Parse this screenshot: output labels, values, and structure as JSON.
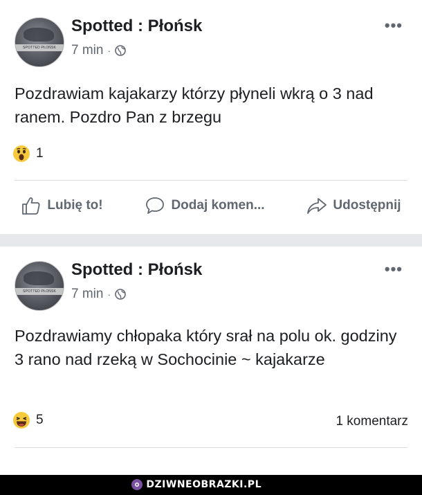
{
  "posts": [
    {
      "page_name": "Spotted : Płońsk",
      "avatar_caption": "SPOTTED PŁOŃSK",
      "time": "7 min",
      "separator": "·",
      "more": "•••",
      "text": "Pozdrawiam kajakarzy którzy płyneli wkrą o 3 nad ranem. Pozdro Pan z brzegu",
      "reaction_icon": "wow-emoji-icon",
      "reaction_count": "1",
      "actions": {
        "like_label": "Lubię to!",
        "comment_label": "Dodaj komen...",
        "share_label": "Udostępnij"
      }
    },
    {
      "page_name": "Spotted : Płońsk",
      "avatar_caption": "SPOTTED PŁOŃSK",
      "time": "7 min",
      "separator": "·",
      "more": "•••",
      "text": "Pozdrawiamy chłopaka który srał na polu ok. godziny 3 rano nad rzeką w Sochocinie ~ kajakarze",
      "reaction_icon": "haha-emoji-icon",
      "reaction_count": "5",
      "comments_count": "1 komentarz"
    }
  ],
  "watermark": {
    "text": "DZIWNEOBRAZKI.PL"
  },
  "colors": {
    "text": "#1c1e21",
    "secondary": "#606770",
    "separator": "#e7e8eb",
    "emoji_yellow": "#f7c93c"
  }
}
